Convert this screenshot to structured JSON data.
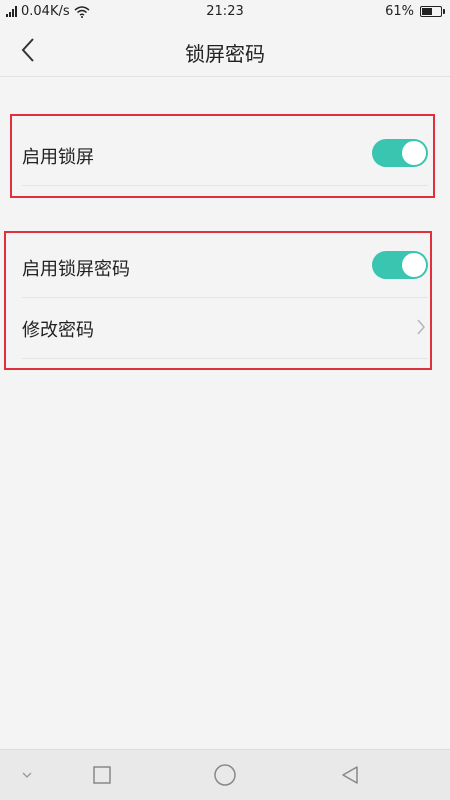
{
  "status_bar": {
    "network_speed": "0.04K/s",
    "time": "21:23",
    "battery_percent": "61%",
    "battery_level": 0.61
  },
  "header": {
    "title": "锁屏密码",
    "back_icon": "chevron-left-icon"
  },
  "section_lock": {
    "rows": [
      {
        "label": "启用锁屏",
        "toggle_on": true
      }
    ]
  },
  "section_password": {
    "rows": [
      {
        "label": "启用锁屏密码",
        "toggle_on": true
      },
      {
        "label": "修改密码",
        "chevron_icon": "chevron-right-icon"
      }
    ]
  },
  "nav_bar": {
    "items": [
      "chevron-down-icon",
      "recent-apps-icon",
      "home-icon",
      "back-triangle-icon"
    ]
  },
  "colors": {
    "toggle_on": "#3ac5b1",
    "highlight_border": "#e0303c",
    "background": "#f4f4f4"
  }
}
